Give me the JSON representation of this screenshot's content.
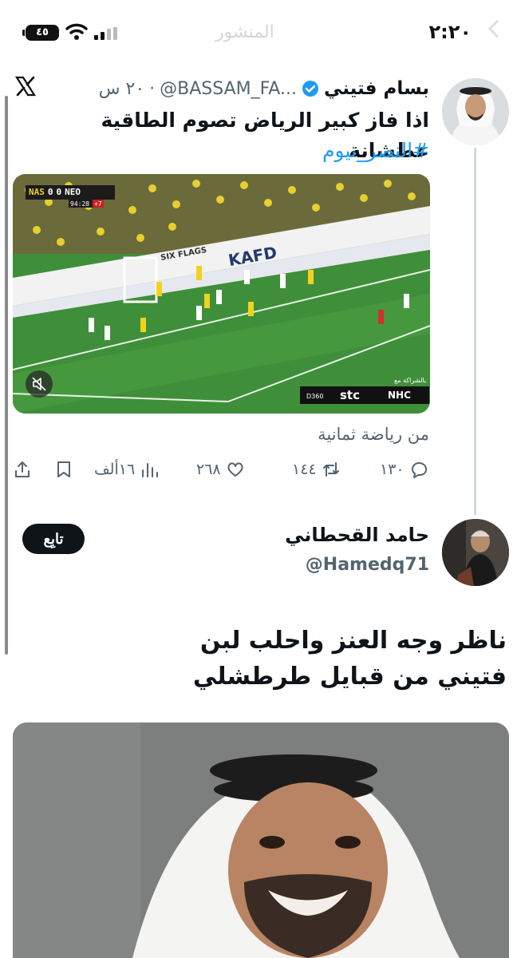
{
  "status_bar": {
    "time": "٢:٢٠",
    "battery": "٤٥",
    "ghost_title": "المنشور"
  },
  "quoted_tweet": {
    "display_name": "بسام فتيني",
    "handle": "@BASSAM_FA...",
    "dot": "·",
    "time_ago": "٢٠ س",
    "text": "اذا فاز كبير الرياض تصوم الطاقية عطشانة",
    "hashtag": "#النصر_نيوم",
    "video": {
      "scoreboard_home": "NAS",
      "scoreboard_home_score": "0",
      "scoreboard_away_score": "0",
      "scoreboard_away": "NEO",
      "clock": "94:28",
      "added_time": "+7",
      "ad_board_1": "KAFD",
      "ad_board_2": "SIX FLAGS",
      "broadcaster_1": "NHC",
      "broadcaster_2": "stc",
      "broadcaster_3": "D360",
      "sponsor_tag": "بالشراكة مع"
    },
    "source": "من رياضة ثمانية",
    "actions": {
      "replies": "١٣٠",
      "retweets": "١٤٤",
      "likes": "٢٦٨",
      "views": "١٦ألف"
    }
  },
  "reply_tweet": {
    "display_name": "حامد القحطاني",
    "handle": "@Hamedq71",
    "follow_label": "تابِع",
    "text_line1": "ناظر وجه العنز واحلب لبن",
    "text_line2": "فتيني من قبايل طرطشلي"
  },
  "colors": {
    "accent": "#1d9bf0",
    "text": "#0f1419",
    "muted": "#536471",
    "pitch": "#3f8f3a"
  }
}
